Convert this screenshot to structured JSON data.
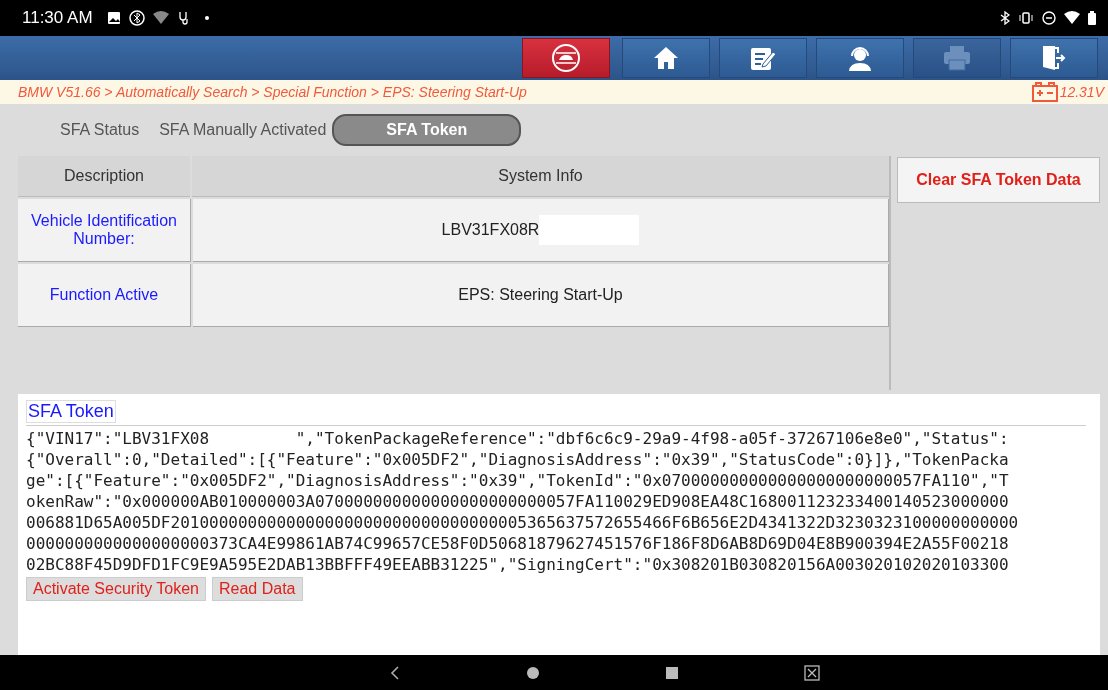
{
  "status_bar": {
    "time": "11:30 AM"
  },
  "toolbar": [
    {
      "kind": "car",
      "disabled": false
    },
    {
      "kind": "home",
      "disabled": false
    },
    {
      "kind": "edit",
      "disabled": false
    },
    {
      "kind": "support",
      "disabled": false
    },
    {
      "kind": "print",
      "disabled": true
    },
    {
      "kind": "exit",
      "disabled": false
    }
  ],
  "breadcrumb": "BMW V51.66 > Automatically Search > Special Function > EPS: Steering Start-Up",
  "battery_voltage": "12.31V",
  "tabs": [
    {
      "label": "SFA Status",
      "selected": false
    },
    {
      "label": "SFA Manually Activated",
      "selected": false
    },
    {
      "label": "SFA Token",
      "selected": true
    }
  ],
  "table": {
    "columns": [
      "Description",
      "System Info"
    ],
    "rows": [
      {
        "label": "Vehicle Identification Number:",
        "value": "LBV31FX08R",
        "redacted": true
      },
      {
        "label": "Function Active",
        "value": "EPS: Steering Start-Up",
        "redacted": false
      }
    ]
  },
  "side_button": "Clear SFA Token Data",
  "token": {
    "title": "SFA Token",
    "lines": [
      "{\"VIN17\":\"LBV31FX08         \",\"TokenPackageReference\":\"dbf6c6c9-29a9-4f98-a05f-37267106e8e0\",\"Status\":",
      "{\"Overall\":0,\"Detailed\":[{\"Feature\":\"0x005DF2\",\"DiagnosisAddress\":\"0x39\",\"StatusCode\":0}]},\"TokenPacka",
      "ge\":[{\"Feature\":\"0x005DF2\",\"DiagnosisAddress\":\"0x39\",\"TokenId\":\"0x070000000000000000000000057FA110\",\"T",
      "okenRaw\":\"0x000000AB010000003A070000000000000000000000057FA110029ED908EA48C168001123233400140523000000",
      "006881D65A005DF2010000000000000000000000000000000005365637572655466F6B656E2D4341322D3230323100000000000",
      "0000000000000000000373CA4E99861AB74C99657CE58F0D50681879627451576F186F8D6AB8D69D04E8B900394E2A55F00218",
      "02BC88F45D9DFD1FC9E9A595E2DAB13BBFFF49EEABB31225\",\"SigningCert\":\"0x308201B030820156A003020102020103300"
    ],
    "buttons": [
      "Activate Security Token",
      "Read Data"
    ]
  }
}
